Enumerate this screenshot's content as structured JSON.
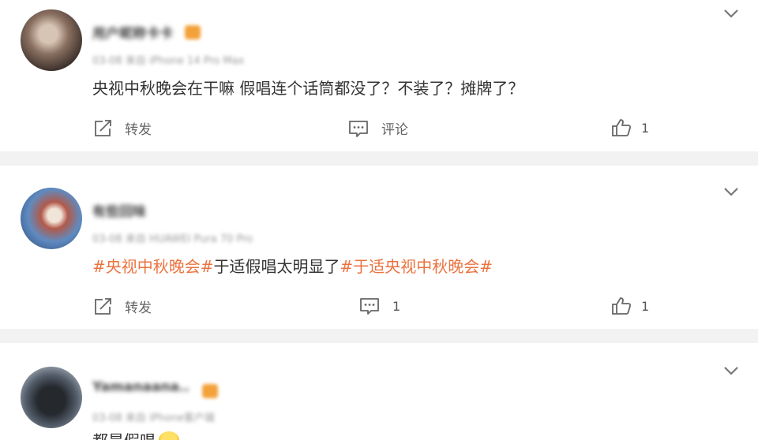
{
  "comments": [
    {
      "username": "用户昵称卡卡",
      "meta": "03-08 来自 iPhone 14 Pro Max",
      "content": "央视中秋晚会在干嘛 假唱连个话筒都没了？不装了？摊牌了？",
      "actions": {
        "repost_label": "转发",
        "comment_label": "评论",
        "like_count": "1"
      }
    },
    {
      "username": "有些回味",
      "meta": "03-08 来自 HUAWEI Pura 70 Pro",
      "content_parts": [
        {
          "text": "#央视中秋晚会#",
          "topic": true
        },
        {
          "text": "于适假唱太明显了",
          "topic": false
        },
        {
          "text": "#于适央视中秋晚会#",
          "topic": true
        }
      ],
      "actions": {
        "repost_label": "转发",
        "comment_count": "1",
        "like_count": "1"
      }
    },
    {
      "username": "Yamanaana..",
      "meta": "03-08 来自 iPhone客户端",
      "content": "都是假唱"
    }
  ],
  "icons": {
    "chevron": "chevron-down-icon",
    "repost": "repost-icon",
    "comment": "comment-icon",
    "like": "thumbs-up-icon"
  },
  "colors": {
    "topic": "#eb7340",
    "background": "#f2f2f2"
  }
}
